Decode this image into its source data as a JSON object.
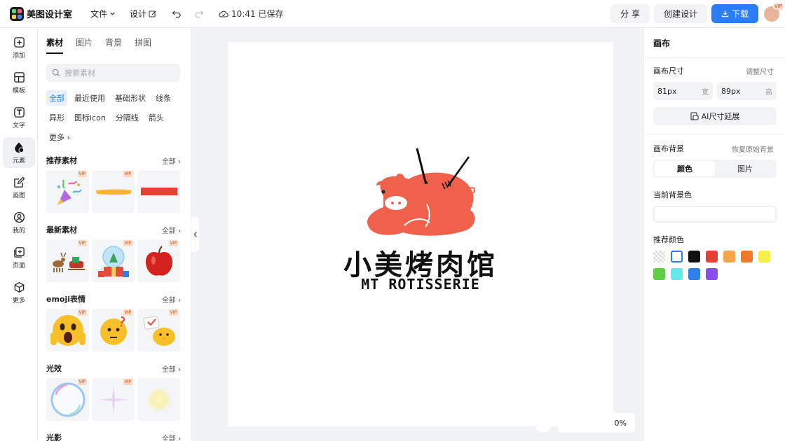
{
  "app": {
    "name": "美图设计室"
  },
  "topbar": {
    "file_label": "文件",
    "design_label": "设计",
    "save_status": "10:41 已保存",
    "share_label": "分 享",
    "create_label": "创建设计",
    "download_label": "下载",
    "vip_badge": "VIP"
  },
  "rail": {
    "items": [
      {
        "label": "添加",
        "icon": "plus-square-icon"
      },
      {
        "label": "模板",
        "icon": "template-icon"
      },
      {
        "label": "文字",
        "icon": "text-icon"
      },
      {
        "label": "元素",
        "icon": "shapes-icon"
      },
      {
        "label": "画图",
        "icon": "draw-icon"
      },
      {
        "label": "我的",
        "icon": "user-icon"
      },
      {
        "label": "页面",
        "icon": "page-add-icon"
      },
      {
        "label": "更多",
        "icon": "cube-icon"
      }
    ],
    "active_index": 3
  },
  "panel": {
    "tabs": [
      "素材",
      "图片",
      "背景",
      "拼图"
    ],
    "search_placeholder": "搜索素材",
    "chips": [
      "全部",
      "最近使用",
      "基础形状",
      "线条",
      "异形",
      "图标icon",
      "分隔线",
      "箭头",
      "更多"
    ],
    "all_label": "全部",
    "vip": "VIP",
    "sections": [
      {
        "title": "推荐素材"
      },
      {
        "title": "最新素材"
      },
      {
        "title": "emoji表情"
      },
      {
        "title": "光效"
      },
      {
        "title": "光影"
      }
    ]
  },
  "canvas": {
    "logo_cn": "小美烤肉馆",
    "logo_en": "MT ROTISSERIE",
    "zoom": "0%"
  },
  "right": {
    "title": "画布",
    "size_label": "画布尺寸",
    "adjust_size": "调整尺寸",
    "width_value": "81px",
    "width_unit": "宽",
    "height_value": "89px",
    "height_unit": "高",
    "ai_extend": "AI尺寸延展",
    "bg_label": "画布背景",
    "restore_bg": "恢复原始背景",
    "seg_color": "颜色",
    "seg_image": "图片",
    "current_bg": "当前背景色",
    "recommend": "推荐颜色",
    "swatches": [
      "transparent",
      "#ffffff",
      "#111111",
      "#e8402f",
      "#f5a54a",
      "#ee7a2a",
      "#f8ef4a",
      "#5fcd45",
      "#63e9ea",
      "#2f80ed",
      "#8a4ded"
    ]
  }
}
